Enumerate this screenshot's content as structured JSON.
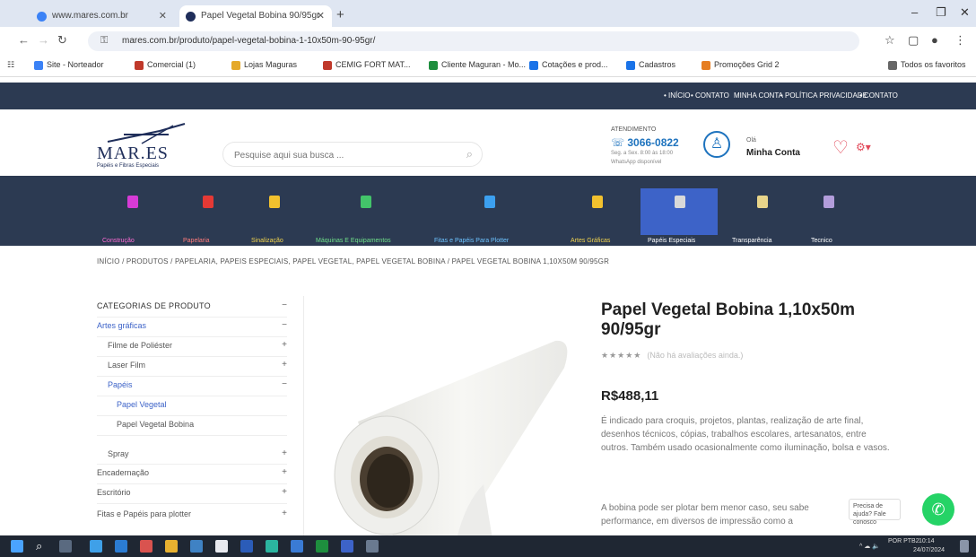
{
  "browser": {
    "tabs": [
      {
        "title": "www.mares.com.br",
        "active": false
      },
      {
        "title": "Papel Vegetal Bobina 90/95gr",
        "active": true
      }
    ],
    "new_tab_glyph": "+",
    "window_controls": [
      "–",
      "❐",
      "✕"
    ],
    "url": "mares.com.br/produto/papel-vegetal-bobina-1-10x50m-90-95gr/",
    "bookmarks": [
      {
        "label": "Site - Norteador",
        "color": "#3b82f6"
      },
      {
        "label": "Comercial (1)",
        "color": "#c0392b"
      },
      {
        "label": "Lojas Maguras",
        "color": "#e5a92a"
      },
      {
        "label": "CEMIG FORT MAT...",
        "color": "#c0392b"
      },
      {
        "label": "Cliente Maguran - Mo...",
        "color": "#1e8e3e"
      },
      {
        "label": "Cotações e prod...",
        "color": "#1a73e8"
      },
      {
        "label": "Cadastros",
        "color": "#1a73e8"
      },
      {
        "label": "Promoções Grid 2",
        "color": "#e67e22"
      },
      {
        "label": "Todos os favoritos",
        "color": "#666666"
      }
    ]
  },
  "site": {
    "toplinks": [
      "• INÍCIO",
      "• CONTATO",
      "MINHA CONTA",
      "• POLÍTICA PRIVACIDADE",
      "• CONTATO"
    ],
    "logo": {
      "name": "MAR.ES",
      "tagline": "Papéis e Fibras Especiais"
    },
    "search": {
      "placeholder": "Pesquise aqui sua busca ..."
    },
    "phone": {
      "label": "ATENDIMENTO",
      "number": "☏ 3066-0822",
      "sub1": "Seg. a Sex. 8:00 às 18:00",
      "sub2": "WhatsApp disponível"
    },
    "account": {
      "small": "Olá",
      "main": "Minha Conta"
    },
    "categories": [
      {
        "label": "Construção",
        "icon_color": "#d63bd6",
        "label_color": "#ff6bd6"
      },
      {
        "label": "Papelaria",
        "icon_color": "#e53935",
        "label_color": "#ff7b7b"
      },
      {
        "label": "Sinalização",
        "icon_color": "#f2c12e",
        "label_color": "#f2d44e"
      },
      {
        "label": "Máquinas E Equipamentos",
        "icon_color": "#43c46a",
        "label_color": "#6fe08a"
      },
      {
        "label": "Fitas e Papéis Para Plotter",
        "icon_color": "#3ca0f0",
        "label_color": "#6cc2ff"
      },
      {
        "label": "Artes Gráficas",
        "icon_color": "#f2c12e",
        "label_color": "#f2d44e"
      },
      {
        "label": "Papéis Especiais",
        "icon_color": "#d9d9d9",
        "label_color": "#ffffff"
      },
      {
        "label": "Transparência",
        "icon_color": "#e8d48a",
        "label_color": "#ffffff"
      },
      {
        "label": "Tecnico",
        "icon_color": "#b39ddb",
        "label_color": "#ffffff"
      }
    ],
    "breadcrumb": "INÍCIO  /  PRODUTOS  /  PAPELARIA, PAPEIS ESPECIAIS, PAPEL VEGETAL, PAPEL VEGETAL BOBINA  /  PAPEL VEGETAL BOBINA 1,10X50M 90/95GR"
  },
  "sidebar": {
    "title": "CATEGORIAS DE PRODUTO",
    "items": [
      {
        "label": "Artes gráficas",
        "level": 0,
        "toggle": "−",
        "color": "#3d63c8"
      },
      {
        "label": "Filme de Poliéster",
        "level": 1,
        "toggle": "+",
        "color": "#555555"
      },
      {
        "label": "Laser Film",
        "level": 1,
        "toggle": "+",
        "color": "#555555"
      },
      {
        "label": "Papéis",
        "level": 1,
        "toggle": "−",
        "color": "#3d63c8"
      },
      {
        "label": "Papel Vegetal",
        "level": 2,
        "toggle": "",
        "color": "#3d63c8"
      },
      {
        "label": "Papel Vegetal Bobina",
        "level": 2,
        "toggle": "",
        "color": "#555555"
      },
      {
        "label": "Spray",
        "level": 1,
        "toggle": "+",
        "color": "#555555"
      },
      {
        "label": "Encadernação",
        "level": 0,
        "toggle": "+",
        "color": "#555555"
      },
      {
        "label": "Escritório",
        "level": 0,
        "toggle": "+",
        "color": "#555555"
      },
      {
        "label": "Fitas e Papéis para plotter",
        "level": 0,
        "toggle": "+",
        "color": "#555555"
      }
    ]
  },
  "product": {
    "title": "Papel Vegetal Bobina 1,10x50m 90/95gr",
    "stars": "★★★★★",
    "rating_text": "(Não há avaliações ainda.)",
    "price": "R$488,11",
    "description": "É indicado para croquis, projetos, plantas, realização de arte final, desenhos técnicos, cópias, trabalhos escolares, artesanatos, entre outros. Também usado ocasionalmente como iluminação, bolsa e vasos.",
    "description2": "A bobina pode ser plotar bem menor caso, seu sabe performance, em diversos de impressão como a",
    "chat_bubble": "Precisa de ajuda? Fale conosco",
    "whatsapp_icon": "whatsapp-icon"
  },
  "taskbar": {
    "time": "10:14",
    "date": "24/07/2024",
    "lang": "POR PTB2"
  }
}
